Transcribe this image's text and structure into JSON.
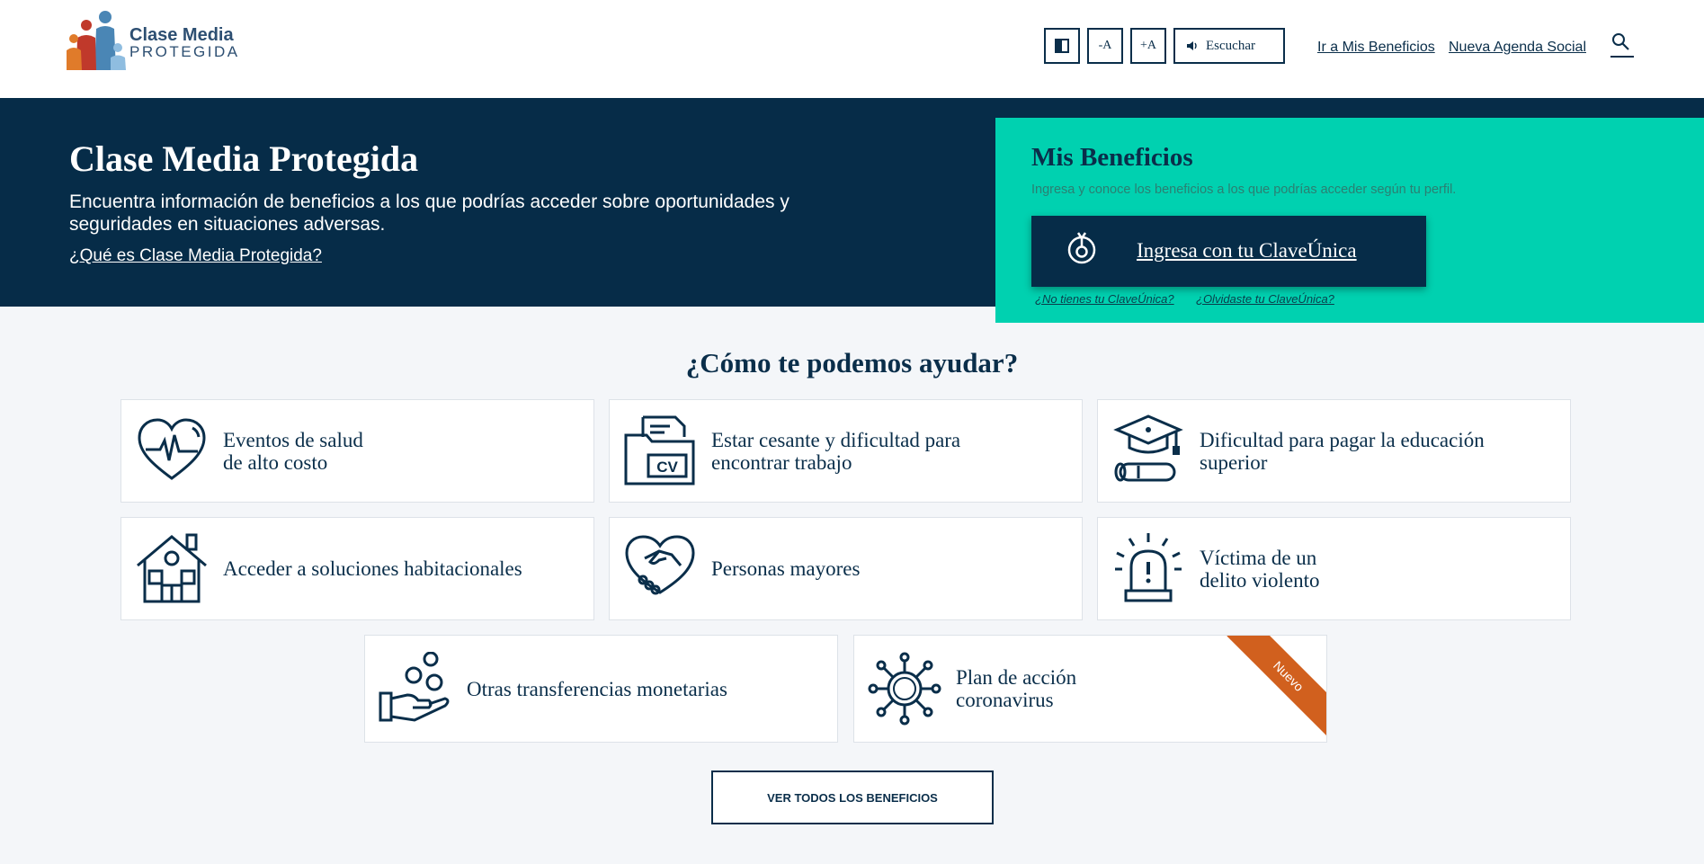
{
  "logo": {
    "line1": "Clase Media",
    "line2": "PROTEGIDA"
  },
  "toolbar": {
    "text_smaller": "-A",
    "text_larger": "+A",
    "listen_label": "Escuchar"
  },
  "header_links": {
    "mis_beneficios": "Ir a Mis Beneficios",
    "agenda_social": "Nueva Agenda Social"
  },
  "hero": {
    "title": "Clase Media Protegida",
    "description": "Encuentra información de beneficios a los que podrías acceder sobre oportunidades y seguridades en situaciones adversas.",
    "link": "¿Qué es Clase Media Protegida?"
  },
  "beneficios": {
    "title": "Mis Beneficios",
    "subtitle": "Ingresa y conoce los beneficios a los que podrías acceder según tu perfil.",
    "button_label": "Ingresa con tu ClaveÚnica",
    "no_clave_link": "¿No tienes tu ClaveÚnica?",
    "forgot_link": "¿Olvidaste tu ClaveÚnica?"
  },
  "main": {
    "title": "¿Cómo te podemos ayudar?",
    "cards": [
      {
        "label": "Eventos de salud\nde alto costo",
        "icon": "heart-pulse-icon"
      },
      {
        "label": "Estar cesante y dificultad para\nencontrar trabajo",
        "icon": "cv-folder-icon"
      },
      {
        "label": "Dificultad para pagar la educación\nsuperior",
        "icon": "graduation-cap-icon"
      },
      {
        "label": "Acceder a soluciones habitacionales",
        "icon": "house-icon"
      },
      {
        "label": "Personas mayores",
        "icon": "heart-handshake-icon"
      },
      {
        "label": "Víctima de un\ndelito violento",
        "icon": "siren-icon"
      },
      {
        "label": "Otras transferencias monetarias",
        "icon": "hand-coins-icon"
      },
      {
        "label": "Plan de acción\ncoronavirus",
        "icon": "virus-icon",
        "badge": "Nuevo"
      }
    ],
    "all_button": "VER TODOS LOS BENEFICIOS"
  },
  "colors": {
    "navy": "#062c48",
    "teal": "#00d1b0",
    "ribbon": "#d1601e",
    "background": "#f4f6f9"
  }
}
